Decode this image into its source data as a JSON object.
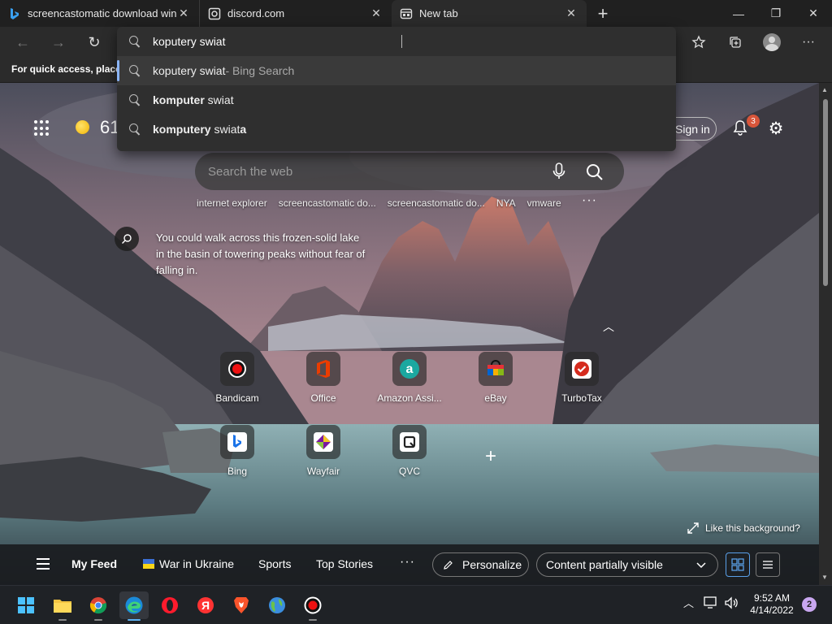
{
  "tabs": [
    {
      "title": "screencastomatic download windows",
      "favicon": "bing-icon"
    },
    {
      "title": "discord.com",
      "favicon": "page-icon"
    },
    {
      "title": "New tab",
      "favicon": "newtab-icon",
      "active": true
    }
  ],
  "address_bar": {
    "value": "koputery swiat",
    "suggestions": [
      {
        "bold": "",
        "text": "koputery swiat",
        "suffix": " - Bing Search",
        "selected": true
      },
      {
        "bold": "komputer",
        "text": " swiat",
        "suffix": ""
      },
      {
        "bold": "komputery",
        "text": " swiat",
        "suffix": "",
        "tail_bold": "a"
      }
    ]
  },
  "favorites_bar": {
    "text": "For quick access, place y"
  },
  "newtab": {
    "weather_temp": "61",
    "signin_label": "Sign in",
    "notification_count": "3",
    "search_placeholder": "Search the web",
    "quick_links": [
      "internet explorer",
      "screencastomatic do...",
      "screencastomatic do...",
      "NYA",
      "vmware"
    ],
    "fact_text": "You could walk across this frozen-solid lake in the basin of towering peaks without fear of falling in.",
    "tiles_row1": [
      {
        "label": "Bandicam",
        "icon": "bandicam-icon"
      },
      {
        "label": "Office",
        "icon": "office-icon"
      },
      {
        "label": "Amazon Assi...",
        "icon": "amazon-icon"
      },
      {
        "label": "eBay",
        "icon": "ebay-icon"
      },
      {
        "label": "TurboTax",
        "icon": "turbotax-icon"
      }
    ],
    "tiles_row2": [
      {
        "label": "Bing",
        "icon": "bing-icon"
      },
      {
        "label": "Wayfair",
        "icon": "wayfair-icon"
      },
      {
        "label": "QVC",
        "icon": "qvc-icon"
      }
    ],
    "like_background": "Like this background?"
  },
  "feed": {
    "my_feed": "My Feed",
    "war_in_ukraine": "War in Ukraine",
    "sports": "Sports",
    "top_stories": "Top Stories",
    "personalize": "Personalize",
    "content_visibility": "Content partially visible"
  },
  "taskbar": {
    "apps": [
      "start-icon",
      "file-explorer-icon",
      "chrome-icon",
      "edge-icon",
      "opera-icon",
      "yandex-icon",
      "brave-icon",
      "earth-app-icon",
      "bandicam-icon"
    ],
    "time": "9:52 AM",
    "date": "4/14/2022",
    "notification_count": "2"
  },
  "colors": {
    "accent": "#5fb2f2",
    "badge": "#d8553a",
    "selection_bar": "#8ab4f8"
  }
}
